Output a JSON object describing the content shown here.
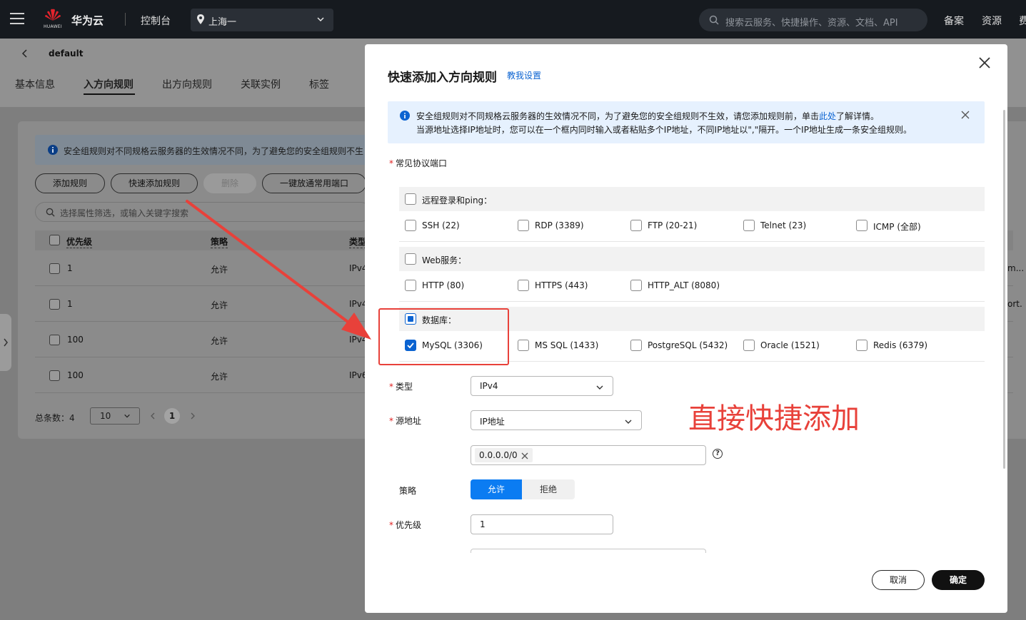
{
  "topbar": {
    "brand": "华为云",
    "logo_text": "HUAWEI",
    "console": "控制台",
    "region": "上海一",
    "search_placeholder": "搜索云服务、快捷操作、资源、文档、API",
    "links": [
      "备案",
      "资源",
      "费"
    ]
  },
  "page": {
    "title": "default",
    "tabs": [
      "基本信息",
      "入方向规则",
      "出方向规则",
      "关联实例",
      "标签"
    ],
    "active_tab": "入方向规则",
    "info_text": "安全组规则对不同规格云服务器的生效情况不同，为了避免您的安全组规则不生",
    "buttons": {
      "add": "添加规则",
      "quick_add": "快速添加规则",
      "delete": "删除",
      "open_common": "一键放通常用端口"
    },
    "filter_placeholder": "选择属性筛选，或输入关键字搜索",
    "columns": [
      "优先级",
      "策略",
      "类型"
    ],
    "rows": [
      {
        "priority": "1",
        "policy": "允许",
        "type": "IPv4"
      },
      {
        "priority": "1",
        "policy": "允许",
        "type": "IPv4"
      },
      {
        "priority": "100",
        "policy": "允许",
        "type": "IPv4"
      },
      {
        "priority": "100",
        "policy": "允许",
        "type": "IPv6"
      }
    ],
    "right_fragments": [
      "m...",
      "ort."
    ],
    "total": "总条数：4",
    "page_size": "10",
    "current_page": "1"
  },
  "modal": {
    "title": "快速添加入方向规则",
    "tutorial_link": "教我设置",
    "info_line1_a": "安全组规则对不同规格云服务器的生效情况不同，为了避免您的安全组规则不生效，请您添加规则前，单击",
    "info_line1_link": "此处",
    "info_line1_b": "了解详情。",
    "info_line2": "当源地址选择IP地址时，您可以在一个框内同时输入或者粘贴多个IP地址，不同IP地址以\",\"隔开。一个IP地址生成一条安全组规则。",
    "ports_label": "常见协议端口",
    "groups": [
      {
        "title": "远程登录和ping：",
        "state": "unchecked",
        "options": [
          {
            "label": "SSH (22)",
            "checked": false
          },
          {
            "label": "RDP (3389)",
            "checked": false
          },
          {
            "label": "FTP (20-21)",
            "checked": false
          },
          {
            "label": "Telnet (23)",
            "checked": false
          },
          {
            "label": "ICMP (全部)",
            "checked": false
          }
        ]
      },
      {
        "title": "Web服务：",
        "state": "unchecked",
        "options": [
          {
            "label": "HTTP (80)",
            "checked": false
          },
          {
            "label": "HTTPS (443)",
            "checked": false
          },
          {
            "label": "HTTP_ALT (8080)",
            "checked": false
          }
        ]
      },
      {
        "title": "数据库：",
        "state": "indeterminate",
        "options": [
          {
            "label": "MySQL (3306)",
            "checked": true
          },
          {
            "label": "MS SQL (1433)",
            "checked": false
          },
          {
            "label": "PostgreSQL (5432)",
            "checked": false
          },
          {
            "label": "Oracle (1521)",
            "checked": false
          },
          {
            "label": "Redis (6379)",
            "checked": false
          }
        ]
      }
    ],
    "type_label": "类型",
    "type_value": "IPv4",
    "source_label": "源地址",
    "source_value": "IP地址",
    "ip_tag": "0.0.0.0/0",
    "policy_label": "策略",
    "policy_allow": "允许",
    "policy_deny": "拒绝",
    "priority_label": "优先级",
    "priority_value": "1",
    "cancel": "取消",
    "confirm": "确定"
  },
  "annotation": {
    "text": "直接快捷添加",
    "color": "#e8413a"
  },
  "colors": {
    "primary": "#0b63d1",
    "topbar": "#161a1f",
    "required": "#e02020"
  }
}
